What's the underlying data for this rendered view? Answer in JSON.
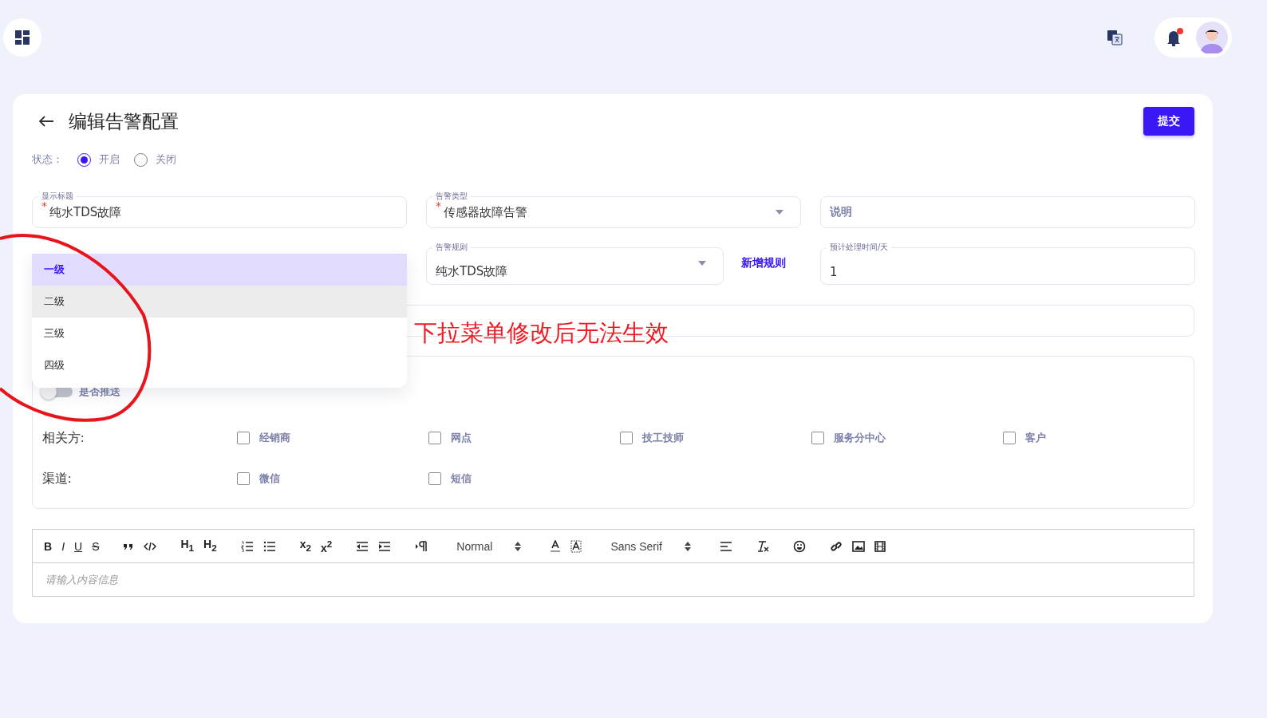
{
  "top_bar": {
    "notifications": {
      "unread": true
    }
  },
  "page": {
    "title": "编辑告警配置",
    "submit": "提交"
  },
  "status": {
    "label": "状态：",
    "options": [
      {
        "label": "开启",
        "selected": true
      },
      {
        "label": "关闭",
        "selected": false
      }
    ]
  },
  "fields_row_1": [
    {
      "label": "显示标题",
      "value": "纯水TDS故障",
      "required_mark": "*",
      "kind": "text"
    },
    {
      "label": "告警类型",
      "value": "传感器故障告警",
      "required_mark": "*",
      "kind": "select"
    },
    {
      "placeholder": "说明",
      "kind": "text"
    }
  ],
  "level_dropdown": {
    "options": [
      {
        "label": "一级",
        "selected": true,
        "highlighted": false
      },
      {
        "label": "二级",
        "selected": false,
        "highlighted": true
      },
      {
        "label": "三级",
        "selected": false,
        "highlighted": false
      },
      {
        "label": "四级",
        "selected": false,
        "highlighted": false
      }
    ]
  },
  "rule_field": {
    "label": "告警规则",
    "value": "纯水TDS故障"
  },
  "add_rule_link": "新增规则",
  "time_field": {
    "label": "预计处理时间/天",
    "value": "1"
  },
  "push": {
    "label": "是否推送",
    "on": false
  },
  "parties": {
    "label": "相关方:",
    "options": [
      {
        "label": "经销商",
        "checked": false
      },
      {
        "label": "网点",
        "checked": false
      },
      {
        "label": "技工技师",
        "checked": false
      },
      {
        "label": "服务分中心",
        "checked": false
      },
      {
        "label": "客户",
        "checked": false
      }
    ]
  },
  "channels": {
    "label": "渠道:",
    "options": [
      {
        "label": "微信",
        "checked": false
      },
      {
        "label": "短信",
        "checked": false
      }
    ]
  },
  "editor": {
    "bold": "B",
    "italic": "I",
    "underline": "U",
    "strike": "S",
    "h1": "H$_{1}$",
    "h2": "H$_{2}$",
    "sub": "x$_{2}$",
    "sup": "x$^{2}$",
    "header": "Normal",
    "font": "Sans Serif",
    "placeholder": "请输入内容信息"
  },
  "annotation": {
    "text": "下拉菜单修改后无法生效"
  }
}
